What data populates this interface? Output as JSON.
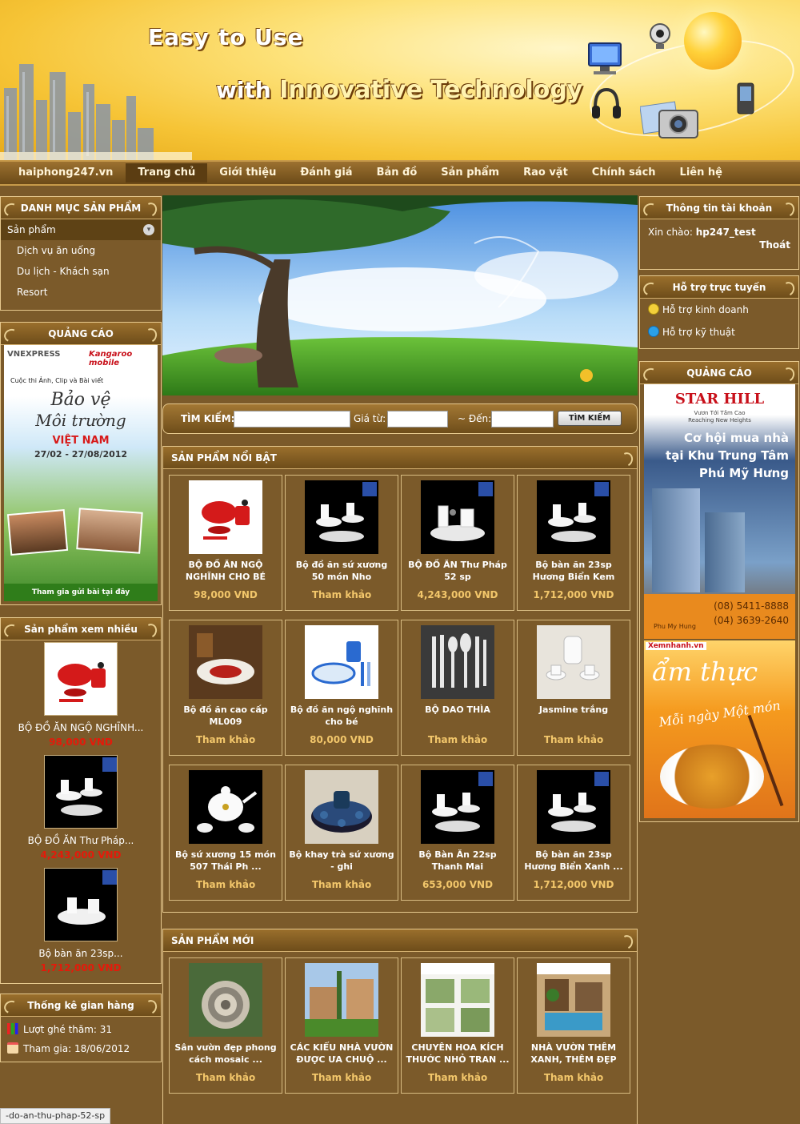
{
  "banner": {
    "slogan_line1": "Easy to Use",
    "slogan_line2_with": "with",
    "slogan_line2_rest": "Innovative Technology"
  },
  "nav": {
    "items": [
      "haiphong247.vn",
      "Trang chủ",
      "Giới thiệu",
      "Đánh giá",
      "Bản đồ",
      "Sản phẩm",
      "Rao vặt",
      "Chính sách",
      "Liên hệ"
    ],
    "active_index": 1
  },
  "left": {
    "category": {
      "title": "DANH MỤC SẢN PHẨM",
      "top": "Sản phẩm",
      "items": [
        "Dịch vụ ăn uống",
        "Du lịch - Khách sạn",
        "Resort"
      ]
    },
    "ad": {
      "title": "QUẢNG CÁO",
      "brand1": "VNEXPRESS",
      "brand2": "Kangaroo mobile",
      "line1": "Cuộc thi Ảnh, Clip và Bài viết",
      "line2": "Bảo vệ",
      "line3": "Môi trường",
      "line4": "VIỆT NAM",
      "dates": "27/02 - 27/08/2012",
      "footer": "Tham gia gửi bài tại đây"
    },
    "most_viewed": {
      "title": "Sản phẩm xem nhiều",
      "items": [
        {
          "name": "BỘ ĐỒ ĂN NGỘ NGHĨNH...",
          "price": "98,000 VND"
        },
        {
          "name": "BỘ ĐỒ ĂN Thư Pháp...",
          "price": "4,243,000 VND"
        },
        {
          "name": "Bộ bàn ăn 23sp...",
          "price": "1,712,000 VND"
        }
      ]
    },
    "stats": {
      "title": "Thống kê gian hàng",
      "visits": "Lượt ghé thăm: 31",
      "joined": "Tham gia: 18/06/2012"
    }
  },
  "search": {
    "label": "TÌM KIẾM:",
    "price_from": "Giá từ:",
    "price_to": "~ Đến:",
    "button": "TÌM KIẾM"
  },
  "featured": {
    "title": "SẢN PHẨM NỔI BẬT",
    "products": [
      {
        "name": "BỘ ĐỒ ĂN NGỘ NGHĨNH CHO BÉ",
        "price": "98,000 VND",
        "thumb": "red"
      },
      {
        "name": "Bộ đồ ăn sứ xương 50 món Nho",
        "price": "Tham khảo",
        "thumb": "china-dark"
      },
      {
        "name": "BỘ ĐỒ ĂN Thư Pháp 52 sp",
        "price": "4,243,000 VND",
        "thumb": "china-white"
      },
      {
        "name": "Bộ bàn ăn 23sp Hương Biển Kem",
        "price": "1,712,000 VND",
        "thumb": "china-dark"
      },
      {
        "name": "Bộ đồ ăn cao cấp ML009",
        "price": "Tham khảo",
        "thumb": "table"
      },
      {
        "name": "Bộ đồ ăn ngộ nghĩnh cho bé",
        "price": "80,000 VND",
        "thumb": "blue"
      },
      {
        "name": "BỘ DAO THÌA",
        "price": "Tham khảo",
        "thumb": "cutlery"
      },
      {
        "name": "Jasmine trắng",
        "price": "Tham khảo",
        "thumb": "teaset-white"
      },
      {
        "name": "Bộ sứ xương 15 món 507 Thái Ph ...",
        "price": "Tham khảo",
        "thumb": "teapot"
      },
      {
        "name": "Bộ khay trà sứ xương - ghi",
        "price": "Tham khảo",
        "thumb": "teatray"
      },
      {
        "name": "Bộ Bàn Ăn 22sp Thanh Mai",
        "price": "653,000 VND",
        "thumb": "china-dark"
      },
      {
        "name": "Bộ bàn ăn 23sp Hương Biển Xanh ...",
        "price": "1,712,000 VND",
        "thumb": "china-dark"
      }
    ]
  },
  "new_products": {
    "title": "SẢN PHẨM MỚI",
    "products": [
      {
        "name": "Sân vườn đẹp phong cách mosaic ...",
        "price": "Tham khảo",
        "thumb": "garden1"
      },
      {
        "name": "CÁC KIỂU NHÀ VƯỜN ĐƯỢC ƯA CHUỘ ...",
        "price": "Tham khảo",
        "thumb": "garden2"
      },
      {
        "name": "CHUYÊN HOA KÍCH THƯỚC NHỎ TRAN ...",
        "price": "Tham khảo",
        "thumb": "garden3"
      },
      {
        "name": "NHÀ VƯỜN THÊM XANH, THÊM ĐẸP",
        "price": "Tham khảo",
        "thumb": "garden4"
      }
    ]
  },
  "right": {
    "account": {
      "title": "Thông tin tài khoản",
      "greeting": "Xin chào:",
      "username": "hp247_test",
      "logout": "Thoát"
    },
    "support": {
      "title": "Hỗ trợ trực tuyến",
      "sales": "Hỗ trợ kinh doanh",
      "tech": "Hỗ trợ kỹ thuật"
    },
    "ads": {
      "title": "QUẢNG CÁO",
      "starhill": "STAR HILL",
      "starhill_sub": "Vươn Tới Tầm Cao",
      "starhill_sub2": "Reaching New Heights",
      "starhill_l1": "Cơ hội mua nhà",
      "starhill_l2": "tại Khu Trung Tâm",
      "starhill_l3": "Phú Mỹ Hưng",
      "starhill_phone1": "(08) 5411-8888",
      "starhill_phone2": "(04) 3639-2640",
      "starhill_brand": "Phu My Hung",
      "xemnhanh": "Xemnhanh.vn",
      "amthuc": "ẩm thực",
      "moingay": "Mỗi ngày Một món"
    }
  },
  "status_bar": "-do-an-thu-phap-52-sp",
  "colors": {
    "page_bg": "#7b5a2a",
    "border": "#e6c98e",
    "price_red": "#e41a0a",
    "price_gold": "#f3c76b"
  }
}
